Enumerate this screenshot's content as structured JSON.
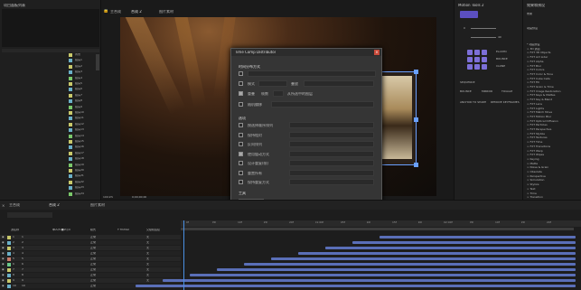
{
  "project": {
    "title": "项目面板列表",
    "items": [
      "背景",
      "镜头1",
      "镜头2",
      "镜头3",
      "镜头4",
      "镜头5",
      "镜头6",
      "镜头7",
      "镜头8",
      "镜头9",
      "镜头10",
      "镜头11",
      "镜头12",
      "镜头13",
      "镜头14",
      "镜头15",
      "镜头16",
      "镜头17",
      "镜头18",
      "镜头19",
      "镜头20",
      "镜头21",
      "镜头22",
      "镜头23",
      "镜头24"
    ]
  },
  "viewer": {
    "tabs": [
      "主合成",
      "合成 2",
      "图片素材"
    ],
    "zoom": "100.9%",
    "timecode": "0;00;00;00"
  },
  "dialog": {
    "title": "Time Comp Distributor",
    "sec_timing": "时间分布方式",
    "lbl_mode": "模式",
    "val_mode": "叠放",
    "lbl_overlap": "重叠",
    "val_overlap": "帧数",
    "val_overlap2": "从所选中的图层",
    "lbl_random": "随机偏移",
    "sec_options": "选项",
    "options": [
      "按选择顺序排列",
      "保持相对",
      "反向排列",
      "使用缓动方式",
      "设计重复(帧)",
      "重置所有",
      "保持重复方式"
    ],
    "sec_preset": "工具",
    "preset_btn": "分布/对齐",
    "count_label": "总数",
    "count_value": "0",
    "apply_btn": "重新生成"
  },
  "motion": {
    "title": "Motion Tools 2",
    "slider1": "0",
    "slider2": "40",
    "elastic": "ELASTIC",
    "bounce": "BOUNCE",
    "clone": "CLONE",
    "sequence": "SEQUENCE",
    "bounce2": "BOUNCE",
    "mirror": "MIRROR",
    "toggle": "TOGGLE",
    "anchor_to_shape": "ANCHOR TO SHAPE",
    "remove_keyframes": "REMOVE KEYFRAMES"
  },
  "effects": {
    "title": "效果和预设",
    "search": "效果",
    "presets_label": "动画预设",
    "items": [
      "* 动画预设",
      "> 3D 通道",
      "> FXT 3D Objects",
      "> FXT Act Lidar",
      "> FXT Alpha",
      "> FXT Blur",
      "> FXT Colors",
      "> FXT Color & Tone",
      "> FXT Cube Cells",
      "> FXT Fill",
      "> FXT Grain & Time",
      "> FXT Image Restoration",
      "> FXT Keys & Mattes",
      "> FXT Key & Blend",
      "> FXT Lens",
      "> FXT Lights",
      "> FXT Match Move",
      "> FXT Motion Blur",
      "> FXT Optical Diffusion",
      "> FXT Particles",
      "> FXT Perspective",
      "> FXT Stylize",
      "> FXT Textures",
      "> FXT Time",
      "> FXT Transitions",
      "> FXT Warp",
      "> FXT Wipes",
      "> Keying",
      "> Matte",
      "> Noise & Grain",
      "> Obsolete",
      "> Perspective",
      "> Simulation",
      "> Stylize",
      "> Text",
      "> Time",
      "> Transition",
      "> Utility",
      "> Yedatanu Cloudsnake"
    ]
  },
  "timeline": {
    "tabs": [
      "主合成",
      "合成 2",
      "图片素材"
    ],
    "columns": [
      "源名称",
      "单⁂\\fx■⊘◎⊙",
      "模式",
      "T TrkMat",
      "父级和链接"
    ],
    "layers": [
      {
        "num": "1",
        "name": "1"
      },
      {
        "num": "2",
        "name": "2"
      },
      {
        "num": "3",
        "name": "3"
      },
      {
        "num": "4",
        "name": "4"
      },
      {
        "num": "5",
        "name": "5"
      },
      {
        "num": "6",
        "name": "6"
      },
      {
        "num": "7",
        "name": "7"
      },
      {
        "num": "8",
        "name": "8"
      },
      {
        "num": "9",
        "name": "9"
      },
      {
        "num": "10",
        "name": "10"
      }
    ],
    "mode_value": "正常",
    "parent_value": "无",
    "ticks": [
      "0f",
      "05f",
      "10f",
      "15f",
      "20f",
      "01:00f",
      "05f",
      "10f",
      "15f",
      "20f",
      "02:00f",
      "05f",
      "10f",
      "15f",
      "20f"
    ]
  },
  "watermark": "En",
  "colors": {
    "accent": "#7c6fd8",
    "bar": "#5a6fb8",
    "panel": "#232323",
    "dialog": "#353535"
  }
}
